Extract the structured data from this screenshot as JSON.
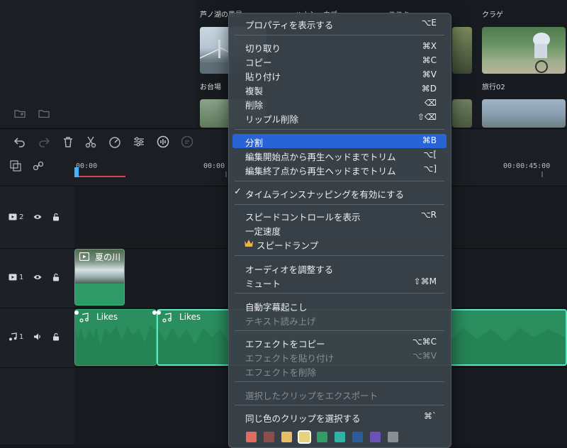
{
  "media": {
    "captions": [
      "芦ノ湖の風景",
      "ハナショウブ",
      "ススキ",
      "クラゲ",
      "お台場",
      "旅行02"
    ]
  },
  "timeline": {
    "ticks": [
      "00:00",
      "00:00",
      "00:00:45:00"
    ],
    "tracks": [
      {
        "index": "2",
        "type": "video"
      },
      {
        "index": "1",
        "type": "video"
      },
      {
        "index": "1",
        "type": "audio"
      }
    ],
    "video_clip_label": "夏の川",
    "audio_clip_labels": [
      "Likes",
      "Likes"
    ]
  },
  "menu": {
    "items": [
      {
        "label": "プロパティを表示する",
        "shortcut": "⌥E"
      },
      {
        "label": "切り取り",
        "shortcut": "⌘X"
      },
      {
        "label": "コピー",
        "shortcut": "⌘C"
      },
      {
        "label": "貼り付け",
        "shortcut": "⌘V"
      },
      {
        "label": "複製",
        "shortcut": "⌘D"
      },
      {
        "label": "削除",
        "shortcut": "⌫"
      },
      {
        "label": "リップル削除",
        "shortcut": "⇧⌫"
      },
      {
        "label": "分割",
        "shortcut": "⌘B"
      },
      {
        "label": "編集開始点から再生ヘッドまでトリム",
        "shortcut": "⌥["
      },
      {
        "label": "編集終了点から再生ヘッドまでトリム",
        "shortcut": "⌥]"
      },
      {
        "label": "タイムラインスナッピングを有効にする",
        "shortcut": ""
      },
      {
        "label": "スピードコントロールを表示",
        "shortcut": "⌥R"
      },
      {
        "label": "一定速度",
        "shortcut": ""
      },
      {
        "label": "スピードランプ",
        "shortcut": ""
      },
      {
        "label": "オーディオを調整する",
        "shortcut": ""
      },
      {
        "label": "ミュート",
        "shortcut": "⇧⌘M"
      },
      {
        "label": "自動字幕起こし",
        "shortcut": ""
      },
      {
        "label": "テキスト読み上げ",
        "shortcut": ""
      },
      {
        "label": "エフェクトをコピー",
        "shortcut": "⌥⌘C"
      },
      {
        "label": "エフェクトを貼り付け",
        "shortcut": "⌥⌘V"
      },
      {
        "label": "エフェクトを削除",
        "shortcut": ""
      },
      {
        "label": "選択したクリップをエクスポート",
        "shortcut": ""
      },
      {
        "label": "同じ色のクリップを選択する",
        "shortcut": "⌘`"
      }
    ],
    "check_mark": "✓",
    "swatches": [
      "#e06b5e",
      "#8c4e4b",
      "#e8bc62",
      "#e6d47a",
      "#2f9e66",
      "#2fb3a8",
      "#2d5c9a",
      "#6b52b8",
      "#8b8f94"
    ]
  }
}
